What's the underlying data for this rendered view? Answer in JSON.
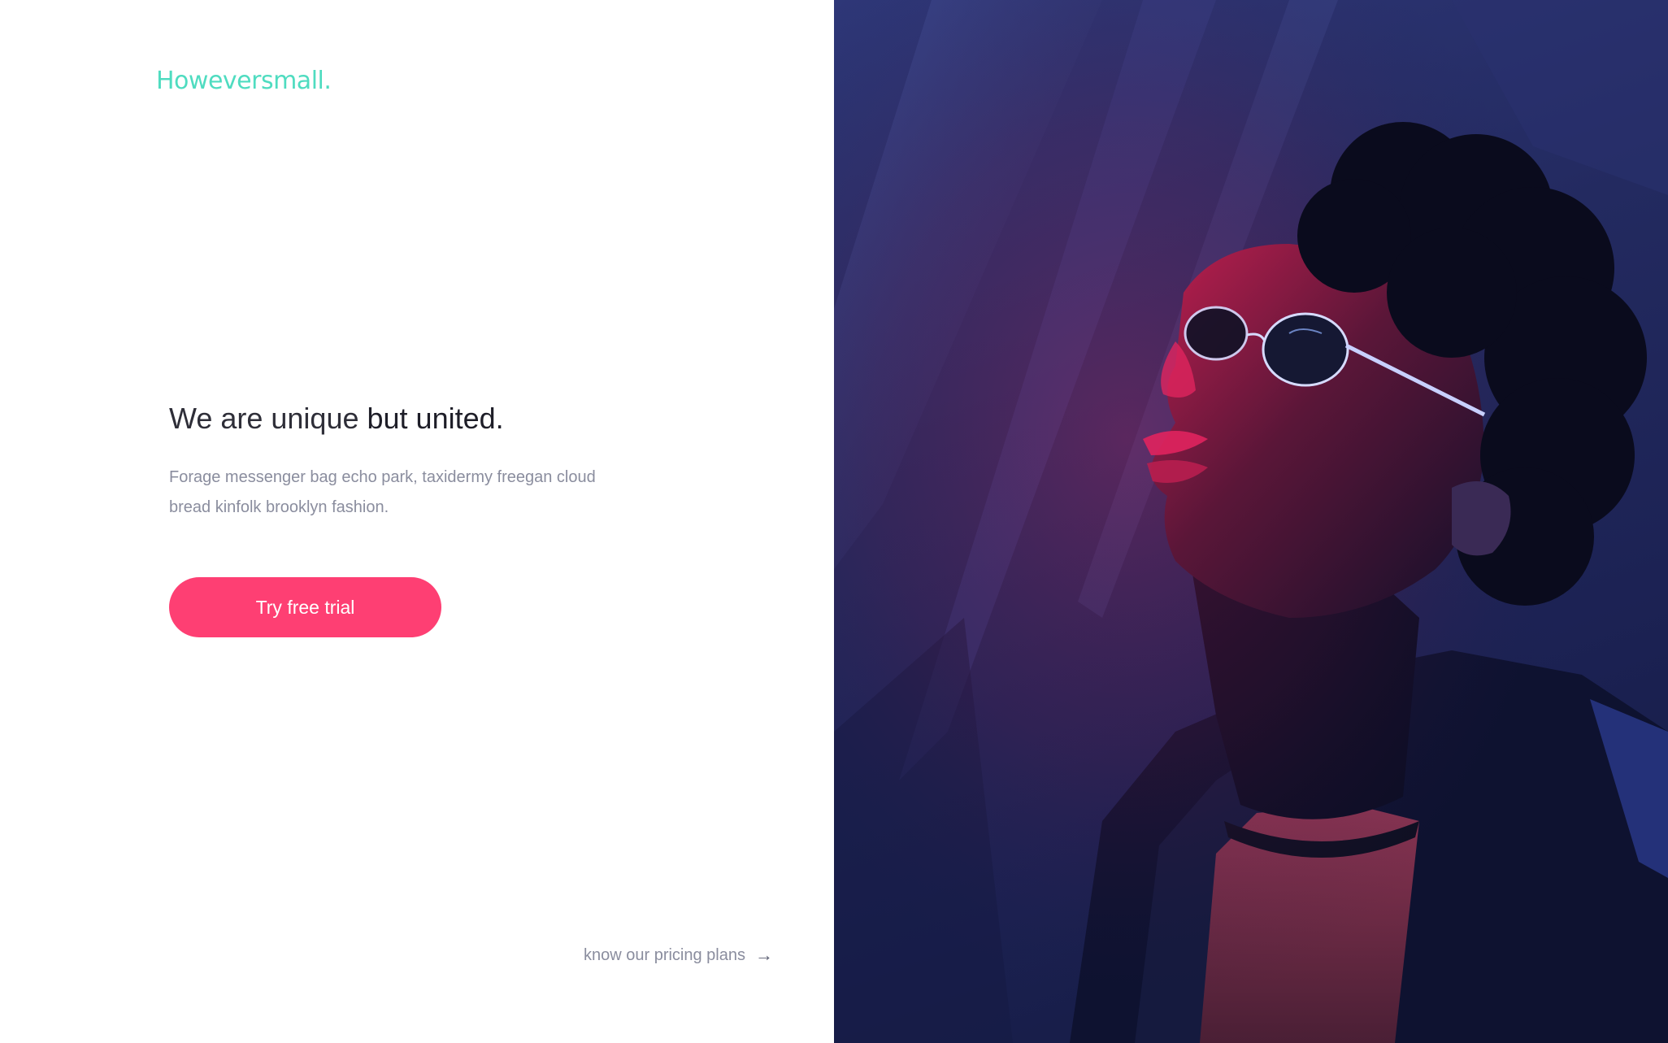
{
  "brand": {
    "logo_text": "Howeversmall."
  },
  "hero": {
    "headline_light": "We are unique ",
    "headline_strong": "but united.",
    "description": "Forage messenger bag echo park, taxidermy freegan cloud bread kinfolk brooklyn fashion.",
    "cta_label": "Try free trial"
  },
  "footer": {
    "pricing_link_label": "know our pricing plans",
    "pricing_arrow": "→"
  },
  "colors": {
    "brand_accent": "#4fdcc0",
    "cta_background": "#fe3f73",
    "headline_text": "#2e2e38",
    "muted_text": "#8a8d9e",
    "photo_blue": "#232a60",
    "photo_red_light": "#e0245e"
  },
  "photo": {
    "icon_name": "portrait-photo"
  }
}
